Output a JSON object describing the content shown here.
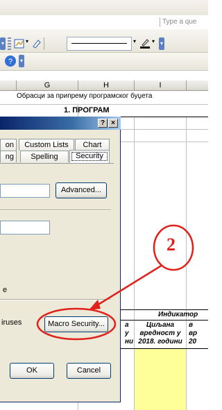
{
  "search": {
    "placeholder": "Type a que"
  },
  "sheet": {
    "columns": [
      "G",
      "H",
      "I"
    ],
    "subtitle": "Обрасци за припрему програмског буџета",
    "program_heading": "1. ПРОГРАМ",
    "indicator_heading": "Индикатор",
    "col_a": "а\nу\nни",
    "target_value": "Циљана\nвредност у\n2018. години",
    "next_col": "в\nвр\n20"
  },
  "dialog": {
    "help_button": "?",
    "close_button": "×",
    "tabs_row1": [
      "on",
      "Custom Lists",
      "Chart"
    ],
    "tabs_row2": [
      "ng",
      "Spelling",
      "Security"
    ],
    "advanced_button": "Advanced...",
    "label_e": "e",
    "label_viruses": "iruses",
    "macro_security_button": "Macro Security...",
    "ok_button": "OK",
    "cancel_button": "Cancel"
  },
  "annotation": {
    "step_number": "2"
  },
  "colors": {
    "accent": "#e0201b",
    "dialog_title": "#0a246a",
    "highlight_cell": "#ffff99"
  },
  "icons": [
    "toolbar-grip-icon",
    "chart-icon",
    "eraser-icon",
    "line-style-icon",
    "pen-color-icon",
    "help-icon",
    "dropdown-arrow-icon"
  ]
}
